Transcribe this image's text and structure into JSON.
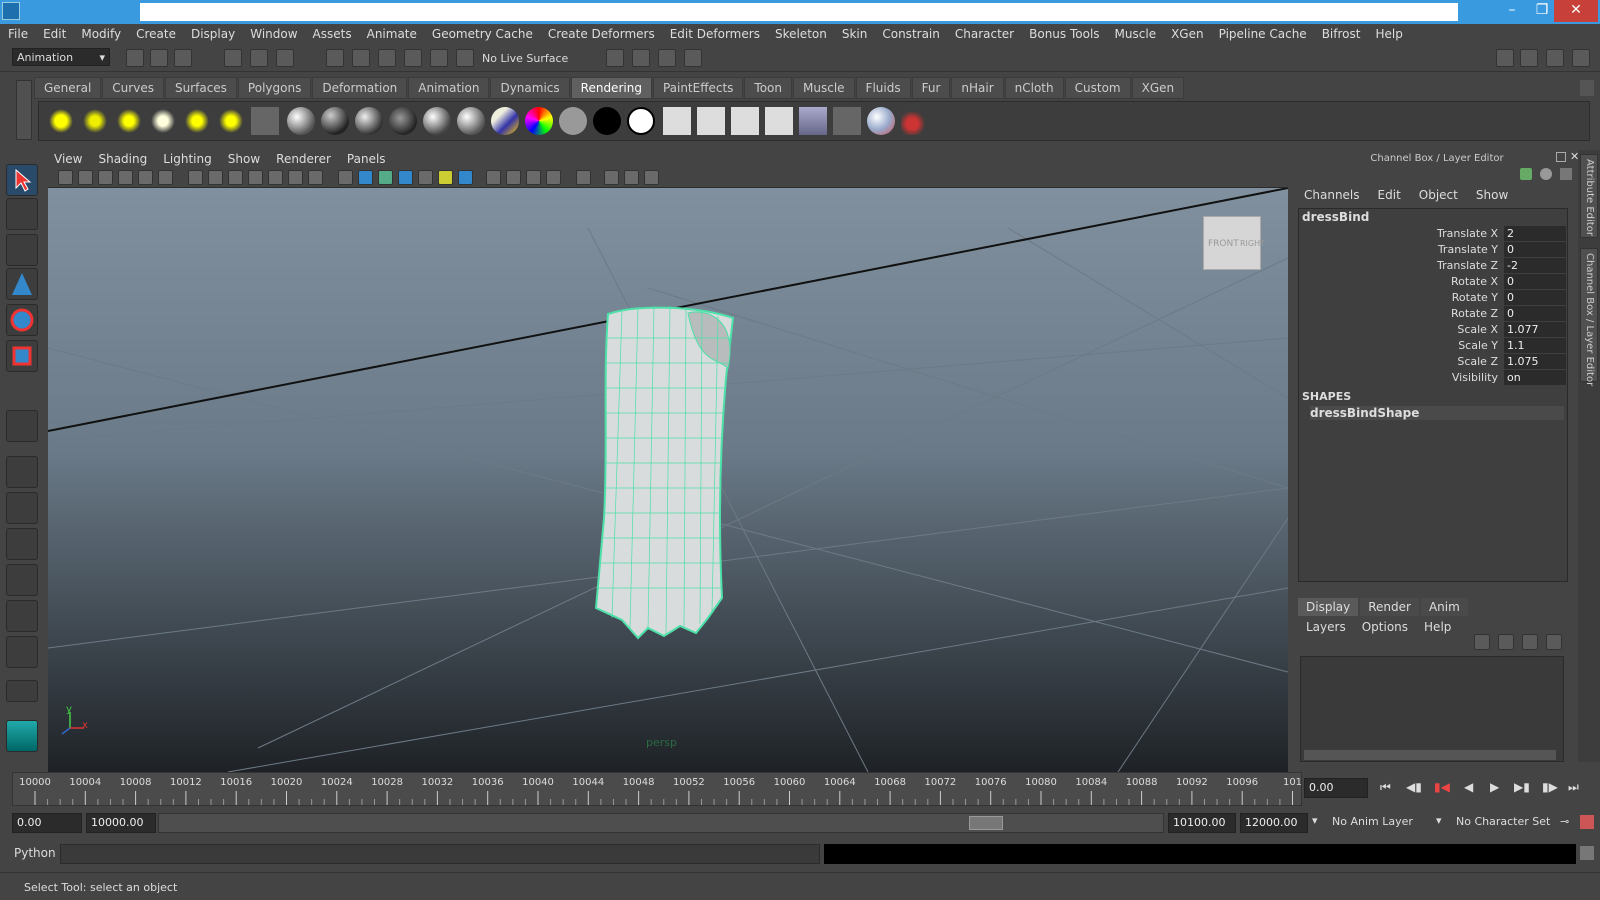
{
  "menu": [
    "File",
    "Edit",
    "Modify",
    "Create",
    "Display",
    "Window",
    "Assets",
    "Animate",
    "Geometry Cache",
    "Create Deformers",
    "Edit Deformers",
    "Skeleton",
    "Skin",
    "Constrain",
    "Character",
    "Bonus Tools",
    "Muscle",
    "XGen",
    "Pipeline Cache",
    "Bifrost",
    "Help"
  ],
  "status": {
    "mode": "Animation",
    "live_surface": "No Live Surface"
  },
  "shelf_tabs": [
    "General",
    "Curves",
    "Surfaces",
    "Polygons",
    "Deformation",
    "Animation",
    "Dynamics",
    "Rendering",
    "PaintEffects",
    "Toon",
    "Muscle",
    "Fluids",
    "Fur",
    "nHair",
    "nCloth",
    "Custom",
    "XGen"
  ],
  "shelf_active": "Rendering",
  "viewport": {
    "menu": [
      "View",
      "Shading",
      "Lighting",
      "Show",
      "Renderer",
      "Panels"
    ],
    "camera": "persp",
    "cube_front": "FRONT",
    "cube_right": "RIGHT",
    "axis_y": "y",
    "axis_x": "x"
  },
  "channel_box": {
    "header": "Channel Box / Layer Editor",
    "menu": [
      "Channels",
      "Edit",
      "Object",
      "Show"
    ],
    "object": "dressBind",
    "channels": [
      {
        "name": "Translate X",
        "value": "2"
      },
      {
        "name": "Translate Y",
        "value": "0"
      },
      {
        "name": "Translate Z",
        "value": "-2"
      },
      {
        "name": "Rotate X",
        "value": "0"
      },
      {
        "name": "Rotate Y",
        "value": "0"
      },
      {
        "name": "Rotate Z",
        "value": "0"
      },
      {
        "name": "Scale X",
        "value": "1.077"
      },
      {
        "name": "Scale Y",
        "value": "1.1"
      },
      {
        "name": "Scale Z",
        "value": "1.075"
      },
      {
        "name": "Visibility",
        "value": "on"
      }
    ],
    "shapes_label": "SHAPES",
    "shape": "dressBindShape"
  },
  "layer_editor": {
    "tabs": [
      "Display",
      "Render",
      "Anim"
    ],
    "menu": [
      "Layers",
      "Options",
      "Help"
    ]
  },
  "side_tabs": [
    "Attribute Editor",
    "Channel Box / Layer Editor"
  ],
  "timeline": {
    "ticks": [
      "10000",
      "10004",
      "10008",
      "10012",
      "10016",
      "10020",
      "10024",
      "10028",
      "10032",
      "10036",
      "10040",
      "10044",
      "10048",
      "10052",
      "10056",
      "10060",
      "10064",
      "10068",
      "10072",
      "10076",
      "10080",
      "10084",
      "10088",
      "10092",
      "10096",
      "101"
    ],
    "current": "0.00"
  },
  "range": {
    "start": "0.00",
    "anim_start": "10000.00",
    "anim_end": "10100.00",
    "end": "12000.00",
    "anim_layer": "No Anim Layer",
    "char_set": "No Character Set"
  },
  "python": {
    "label": "Python"
  },
  "help": "Select Tool: select an object",
  "colors": {
    "accent": "#3a9ae0",
    "wire": "#4de0a8",
    "bg": "#444444"
  }
}
